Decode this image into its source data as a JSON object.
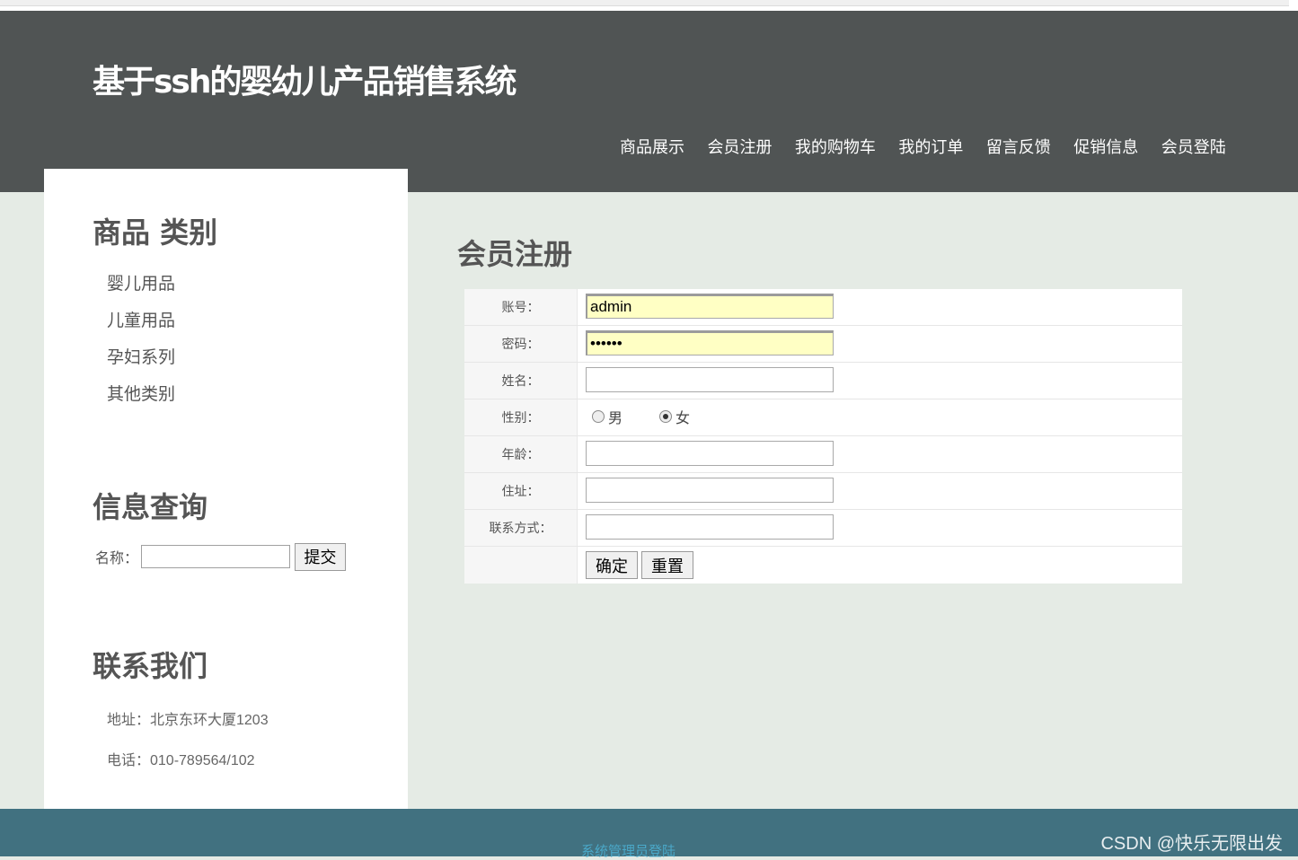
{
  "header": {
    "title": "基于ssh的婴幼儿产品销售系统",
    "nav": [
      "商品展示",
      "会员注册",
      "我的购物车",
      "我的订单",
      "留言反馈",
      "促销信息",
      "会员登陆"
    ]
  },
  "sidebar": {
    "category_title": "商品 类别",
    "categories": [
      "婴儿用品",
      "儿童用品",
      "孕妇系列",
      "其他类别"
    ],
    "query_title": "信息查询",
    "query_label": "名称：",
    "query_value": "",
    "query_button": "提交",
    "contact_title": "联系我们",
    "address": "地址：北京东环大厦1203",
    "phone": "电话：010-789564/102"
  },
  "main": {
    "title": "会员注册",
    "fields": {
      "account_label": "账号：",
      "account_value": "admin",
      "password_label": "密码：",
      "password_value": "123456",
      "name_label": "姓名：",
      "name_value": "",
      "gender_label": "性别：",
      "gender_options": [
        "男",
        "女"
      ],
      "gender_selected": "女",
      "age_label": "年龄：",
      "age_value": "",
      "address_label": "住址：",
      "address_value": "",
      "contact_label": "联系方式：",
      "contact_value": ""
    },
    "confirm_button": "确定",
    "reset_button": "重置"
  },
  "footer": {
    "admin_link": "系统管理员登陆",
    "watermark": "CSDN @快乐无限出发"
  },
  "colors": {
    "header_bg": "#505454",
    "page_bg": "#e5ebe5",
    "footer_bg": "#417180",
    "link": "#4aa8c8",
    "autofill": "#ffffc4"
  }
}
